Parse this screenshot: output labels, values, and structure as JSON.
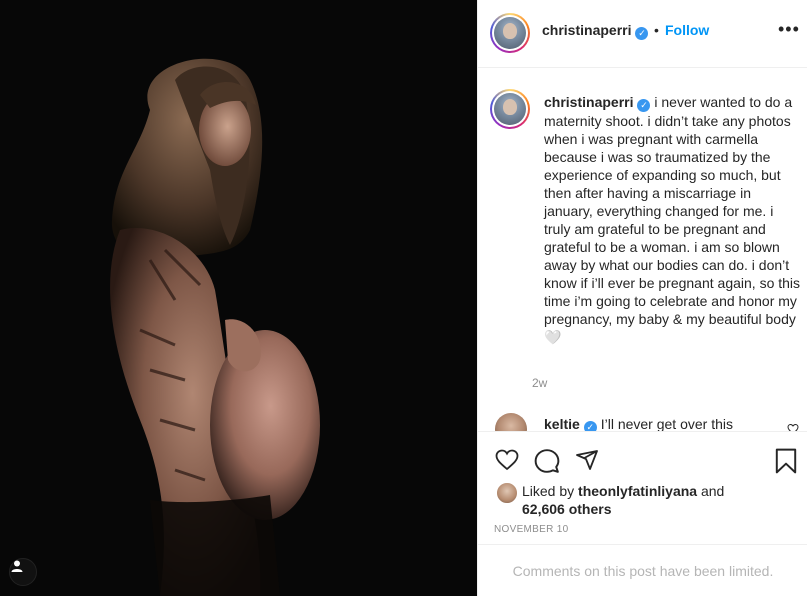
{
  "post": {
    "username": "christinaperri",
    "separator": "•",
    "follow_label": "Follow",
    "more_label": "•••",
    "verified_mark": "✓"
  },
  "caption": {
    "username": "christinaperri",
    "text": " i never wanted to do a maternity shoot. i didn’t take any photos when i was pregnant with carmella because i was so traumatized by the experience of expanding so much, but then after having a miscarriage in january, everything changed for me. i truly am grateful to be pregnant and grateful to be a woman. i am so blown away by what our bodies can do. i don’t know if i’ll ever be pregnant again, so this time i’m going to celebrate and honor my pregnancy, my baby & my beautiful body🤍",
    "time": "2w"
  },
  "comment": {
    "username": "keltie",
    "text": " I’ll never get over this"
  },
  "likes": {
    "prefix": "Liked by ",
    "liker": "theonlyfatinliyana",
    "joiner": " and",
    "others": "62,606 others"
  },
  "date": "NOVEMBER 10",
  "comments_limited": "Comments on this post have been limited.",
  "icons": [
    "heart-icon",
    "comment-icon",
    "share-icon",
    "bookmark-icon",
    "more-icon",
    "verified-icon",
    "user-tag-icon"
  ],
  "colors": {
    "link": "#0095f6",
    "verified": "#3897f0",
    "muted": "#8e8e8e",
    "border": "#efefef",
    "photo_bg": "#070707"
  }
}
